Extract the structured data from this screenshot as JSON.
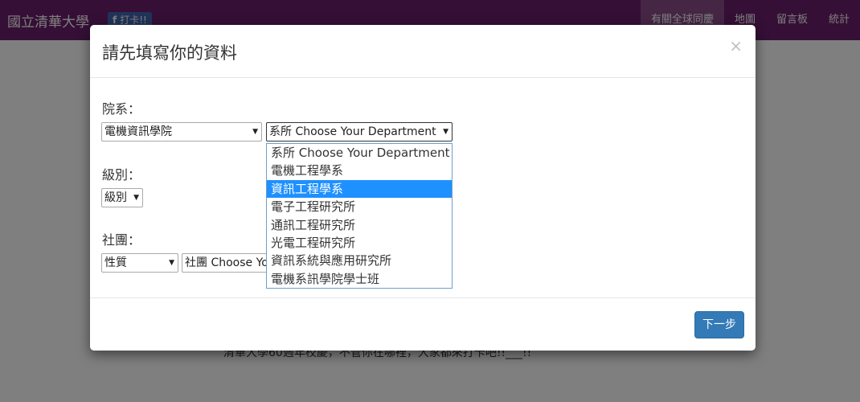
{
  "navbar": {
    "brand": "國立清華大學",
    "fb_like": "打卡!!",
    "fb_icon": "f",
    "items": [
      {
        "label": "有關全球同慶"
      },
      {
        "label": "地圖"
      },
      {
        "label": "留言板"
      },
      {
        "label": "統計"
      }
    ]
  },
  "page": {
    "text": "清華大學60週年校慶，不管你在哪裡，大家都來打卡吧!!___!!"
  },
  "modal": {
    "title": "請先填寫你的資料",
    "close_label": "×",
    "college_label": "院系：",
    "college_select": "電機資訊學院",
    "department_select": "系所 Choose Your Department",
    "grade_label": "級別：",
    "grade_select": "級別",
    "club_label": "社團：",
    "club_type_select": "性質",
    "club_select": "社團 Choose Your Club",
    "next_button": "下一步"
  },
  "department_options": [
    {
      "label": "系所 Choose Your Department",
      "selected": false
    },
    {
      "label": "電機工程學系",
      "selected": false
    },
    {
      "label": "資訊工程學系",
      "selected": true
    },
    {
      "label": "電子工程研究所",
      "selected": false
    },
    {
      "label": "通訊工程研究所",
      "selected": false
    },
    {
      "label": "光電工程研究所",
      "selected": false
    },
    {
      "label": "資訊系統與應用研究所",
      "selected": false
    },
    {
      "label": "電機系訊學院學士班",
      "selected": false
    }
  ],
  "colors": {
    "navbar": "#6b1f6b",
    "primary_button": "#337ab7",
    "highlight": "#1e90ff"
  }
}
